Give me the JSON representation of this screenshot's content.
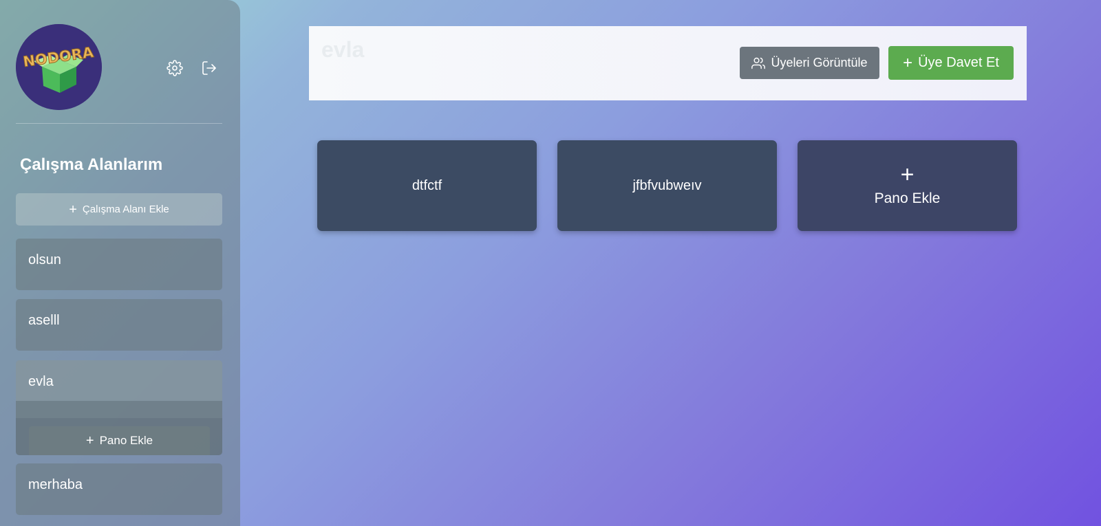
{
  "sidebar": {
    "logo_text": "NODORA",
    "section_title": "Çalışma Alanlarım",
    "add_workspace_label": "Çalışma Alanı Ekle",
    "workspaces": [
      {
        "name": "olsun"
      },
      {
        "name": "aselll"
      },
      {
        "name": "evla",
        "active": true,
        "add_board_label": "Pano Ekle"
      },
      {
        "name": "merhaba"
      }
    ],
    "icons": [
      "gear-icon",
      "logout-icon",
      "plus-icon"
    ]
  },
  "header": {
    "title": "evla",
    "view_members_label": "Üyeleri Görüntüle",
    "invite_member_label": "Üye Davet Et"
  },
  "boards": [
    {
      "name": "dtfctf"
    },
    {
      "name": "jfbfvubweıv"
    }
  ],
  "add_board": {
    "label": "Pano Ekle",
    "icon": "+"
  },
  "colors": {
    "invite_button": "#5cab4f",
    "members_button": "#6c757d",
    "board_card": "#3c4b63",
    "logo_bg": "#3a2f7a"
  }
}
